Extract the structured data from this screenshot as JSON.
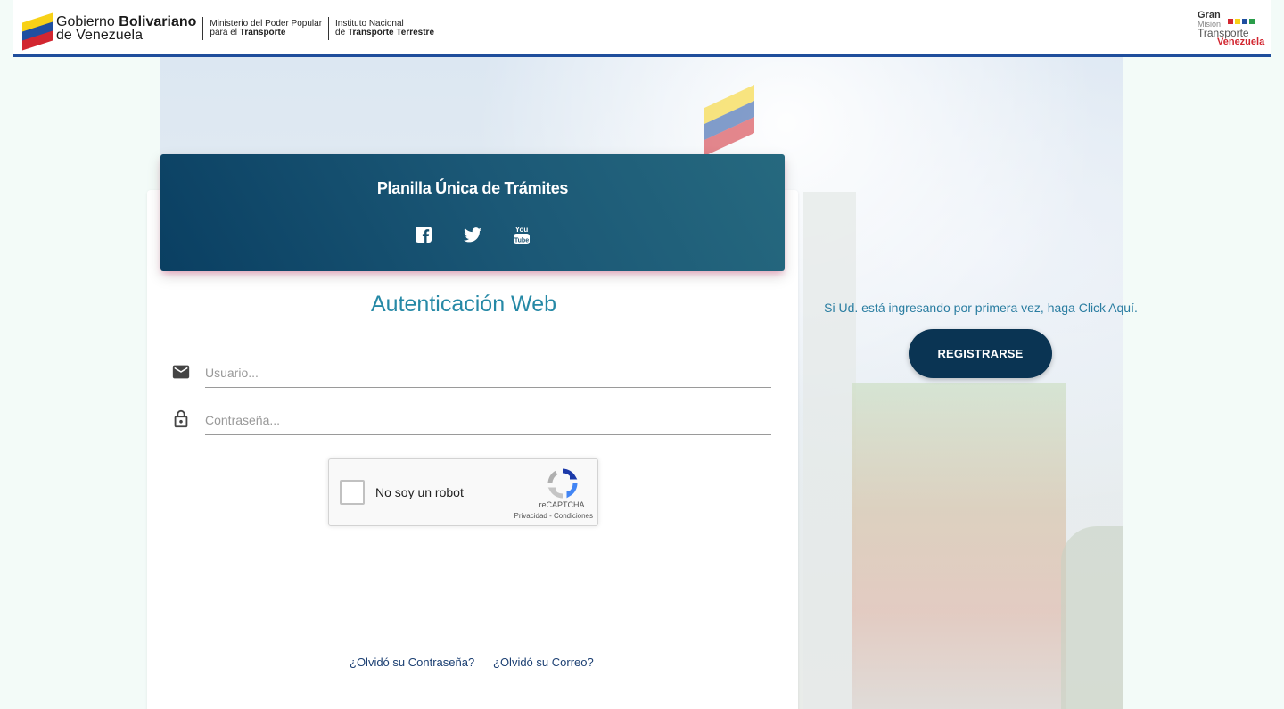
{
  "header": {
    "gov_line1_light": "Gobierno ",
    "gov_line1_bold": "Bolivariano",
    "gov_line2": "de Venezuela",
    "ministry_line1": "Ministerio del Poder Popular",
    "ministry_line2_light": "para el ",
    "ministry_line2_bold": "Transporte",
    "institute_line1": "Instituto Nacional",
    "institute_line2_light": "de ",
    "institute_line2_bold": "Transporte Terrestre",
    "gran_l1": "Gran",
    "gran_l2": "Misión",
    "gran_l3": "Transporte",
    "gran_l4": "Venezuela"
  },
  "card": {
    "title": "Planilla Única de Trámites",
    "socials": [
      "facebook-icon",
      "twitter-icon",
      "youtube-icon"
    ],
    "auth_title": "Autenticación Web"
  },
  "form": {
    "username_placeholder": "Usuario...",
    "password_placeholder": "Contraseña...",
    "captcha_label": "No soy un robot",
    "captcha_brand": "reCAPTCHA",
    "captcha_privacy": "Privacidad",
    "captcha_separator": " - ",
    "captcha_terms": "Condiciones",
    "forgot_password": "¿Olvidó su Contraseña?",
    "forgot_email": "¿Olvidó su Correo?"
  },
  "register": {
    "prompt": "Si Ud. está ingresando por primera vez, haga Click Aquí.",
    "button": "REGISTRARSE"
  },
  "colors": {
    "header_start": "#0a3f62",
    "header_end": "#26697f",
    "accent_text": "#2689a6",
    "register_button": "#0a3453",
    "top_border": "#1f4e9c"
  }
}
